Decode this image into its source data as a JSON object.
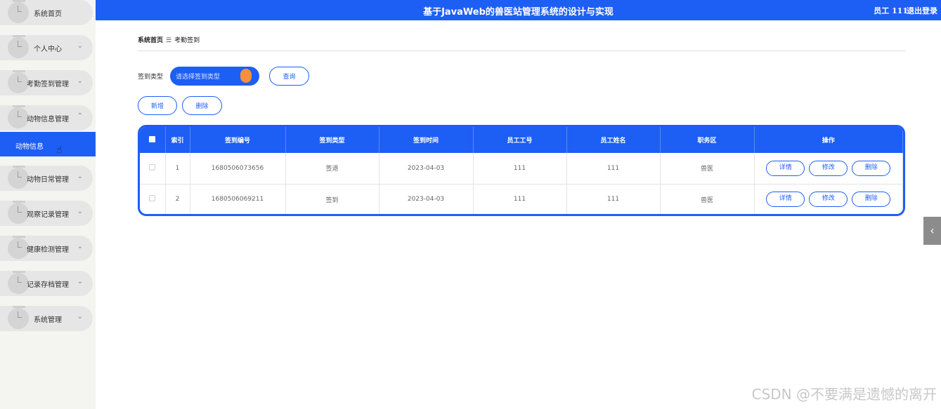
{
  "header": {
    "title": "基于JavaWeb的兽医站管理系统的设计与实现",
    "user": "员工 111",
    "logout": "退出登录"
  },
  "sidebar": {
    "items": [
      {
        "label": "系统首页",
        "chevron": ""
      },
      {
        "label": "个人中心",
        "chevron": "⌄"
      },
      {
        "label": "考勤签到管理",
        "chevron": "⌄"
      },
      {
        "label": "动物信息管理",
        "chevron": "⌃"
      },
      {
        "label": "动物日常管理",
        "chevron": "⌄"
      },
      {
        "label": "观察记录管理",
        "chevron": "⌄"
      },
      {
        "label": "健康检测管理",
        "chevron": "⌄"
      },
      {
        "label": "记录存档管理",
        "chevron": "⌄"
      },
      {
        "label": "系统管理",
        "chevron": "⌄"
      }
    ],
    "active_sub": "动物信息"
  },
  "breadcrumb": {
    "home": "系统首页",
    "separator": "☰",
    "current": "考勤签到"
  },
  "search": {
    "label": "签到类型",
    "placeholder": "请选择签到类型",
    "query_button": "查询"
  },
  "actions": {
    "add": "新增",
    "delete": "删除"
  },
  "table": {
    "columns": [
      "索引",
      "签到编号",
      "签到类型",
      "签到时间",
      "员工工号",
      "员工姓名",
      "职务区",
      "操作"
    ],
    "rows": [
      {
        "index": "1",
        "code": "1680506073656",
        "type": "签退",
        "time": "2023-04-03",
        "emp_no": "111",
        "emp_name": "111",
        "area": "兽医"
      },
      {
        "index": "2",
        "code": "1680506069211",
        "type": "签到",
        "time": "2023-04-03",
        "emp_no": "111",
        "emp_name": "111",
        "area": "兽医"
      }
    ],
    "row_actions": {
      "detail": "详情",
      "edit": "修改",
      "delete": "删除"
    }
  },
  "toggle_icon": "‹",
  "watermark": "CSDN @不要满是遗憾的离开",
  "colors": {
    "primary": "#1d5ef5",
    "accent": "#f4913a",
    "sidebar_bg": "#f4f4f0"
  }
}
